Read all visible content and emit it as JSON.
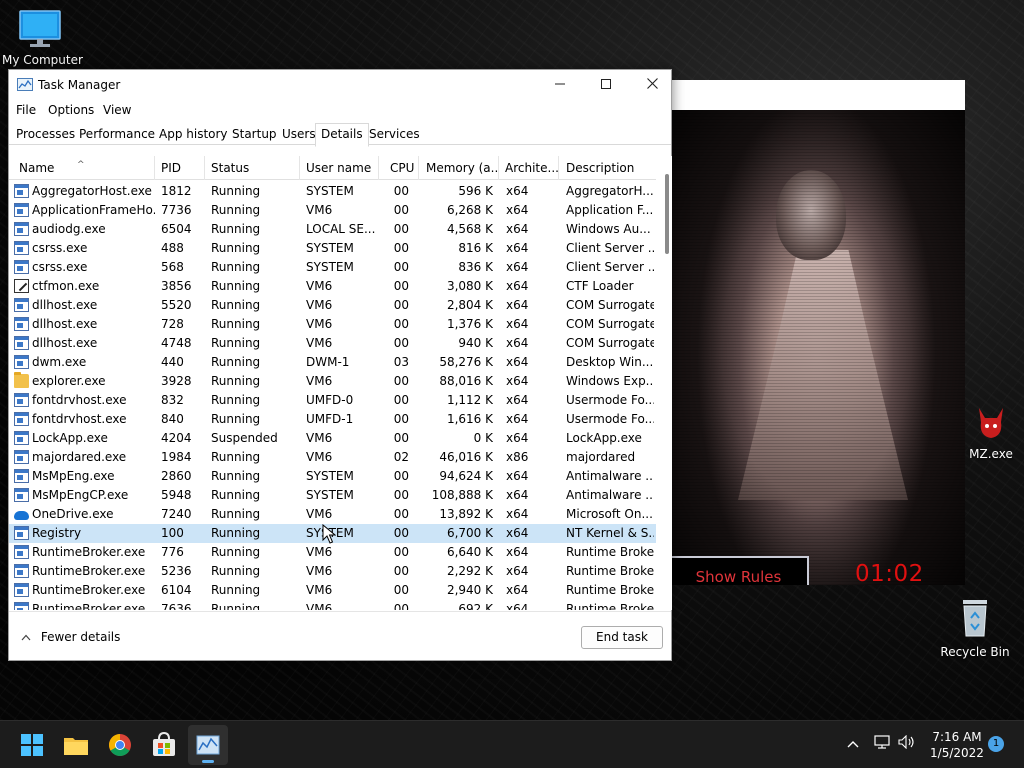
{
  "desktop": {
    "icons": {
      "my_computer": "My Computer",
      "recycle_bin": "Recycle Bin",
      "mz_exe": "MZ.exe"
    }
  },
  "game_window": {
    "show_rules_label": "Show Rules",
    "timer": "01:02"
  },
  "task_manager": {
    "title": "Task Manager",
    "menu": [
      "File",
      "Options",
      "View"
    ],
    "tabs": [
      "Processes",
      "Performance",
      "App history",
      "Startup",
      "Users",
      "Details",
      "Services"
    ],
    "active_tab": "Details",
    "columns": [
      "Name",
      "PID",
      "Status",
      "User name",
      "CPU",
      "Memory (a...",
      "Archite...",
      "Description"
    ],
    "processes": [
      {
        "name": "AggregatorHost.exe",
        "pid": "1812",
        "status": "Running",
        "user": "SYSTEM",
        "cpu": "00",
        "mem": "596 K",
        "arch": "x64",
        "desc": "AggregatorH...",
        "icon": "std"
      },
      {
        "name": "ApplicationFrameHo...",
        "pid": "7736",
        "status": "Running",
        "user": "VM6",
        "cpu": "00",
        "mem": "6,268 K",
        "arch": "x64",
        "desc": "Application F...",
        "icon": "std"
      },
      {
        "name": "audiodg.exe",
        "pid": "6504",
        "status": "Running",
        "user": "LOCAL SE...",
        "cpu": "00",
        "mem": "4,568 K",
        "arch": "x64",
        "desc": "Windows Au...",
        "icon": "std"
      },
      {
        "name": "csrss.exe",
        "pid": "488",
        "status": "Running",
        "user": "SYSTEM",
        "cpu": "00",
        "mem": "816 K",
        "arch": "x64",
        "desc": "Client Server ...",
        "icon": "std"
      },
      {
        "name": "csrss.exe",
        "pid": "568",
        "status": "Running",
        "user": "SYSTEM",
        "cpu": "00",
        "mem": "836 K",
        "arch": "x64",
        "desc": "Client Server ...",
        "icon": "std"
      },
      {
        "name": "ctfmon.exe",
        "pid": "3856",
        "status": "Running",
        "user": "VM6",
        "cpu": "00",
        "mem": "3,080 K",
        "arch": "x64",
        "desc": "CTF Loader",
        "icon": "ctf"
      },
      {
        "name": "dllhost.exe",
        "pid": "5520",
        "status": "Running",
        "user": "VM6",
        "cpu": "00",
        "mem": "2,804 K",
        "arch": "x64",
        "desc": "COM Surrogate",
        "icon": "std"
      },
      {
        "name": "dllhost.exe",
        "pid": "728",
        "status": "Running",
        "user": "VM6",
        "cpu": "00",
        "mem": "1,376 K",
        "arch": "x64",
        "desc": "COM Surrogate",
        "icon": "std"
      },
      {
        "name": "dllhost.exe",
        "pid": "4748",
        "status": "Running",
        "user": "VM6",
        "cpu": "00",
        "mem": "940 K",
        "arch": "x64",
        "desc": "COM Surrogate",
        "icon": "std"
      },
      {
        "name": "dwm.exe",
        "pid": "440",
        "status": "Running",
        "user": "DWM-1",
        "cpu": "03",
        "mem": "58,276 K",
        "arch": "x64",
        "desc": "Desktop Win...",
        "icon": "std"
      },
      {
        "name": "explorer.exe",
        "pid": "3928",
        "status": "Running",
        "user": "VM6",
        "cpu": "00",
        "mem": "88,016 K",
        "arch": "x64",
        "desc": "Windows Exp...",
        "icon": "folder"
      },
      {
        "name": "fontdrvhost.exe",
        "pid": "832",
        "status": "Running",
        "user": "UMFD-0",
        "cpu": "00",
        "mem": "1,112 K",
        "arch": "x64",
        "desc": "Usermode Fo...",
        "icon": "std"
      },
      {
        "name": "fontdrvhost.exe",
        "pid": "840",
        "status": "Running",
        "user": "UMFD-1",
        "cpu": "00",
        "mem": "1,616 K",
        "arch": "x64",
        "desc": "Usermode Fo...",
        "icon": "std"
      },
      {
        "name": "LockApp.exe",
        "pid": "4204",
        "status": "Suspended",
        "user": "VM6",
        "cpu": "00",
        "mem": "0 K",
        "arch": "x64",
        "desc": "LockApp.exe",
        "icon": "std"
      },
      {
        "name": "majordared.exe",
        "pid": "1984",
        "status": "Running",
        "user": "VM6",
        "cpu": "02",
        "mem": "46,016 K",
        "arch": "x86",
        "desc": "majordared",
        "icon": "std"
      },
      {
        "name": "MsMpEng.exe",
        "pid": "2860",
        "status": "Running",
        "user": "SYSTEM",
        "cpu": "00",
        "mem": "94,624 K",
        "arch": "x64",
        "desc": "Antimalware ...",
        "icon": "std"
      },
      {
        "name": "MsMpEngCP.exe",
        "pid": "5948",
        "status": "Running",
        "user": "SYSTEM",
        "cpu": "00",
        "mem": "108,888 K",
        "arch": "x64",
        "desc": "Antimalware ...",
        "icon": "std"
      },
      {
        "name": "OneDrive.exe",
        "pid": "7240",
        "status": "Running",
        "user": "VM6",
        "cpu": "00",
        "mem": "13,892 K",
        "arch": "x64",
        "desc": "Microsoft On...",
        "icon": "cloud"
      },
      {
        "name": "Registry",
        "pid": "100",
        "status": "Running",
        "user": "SYSTEM",
        "cpu": "00",
        "mem": "6,700 K",
        "arch": "x64",
        "desc": "NT Kernel & S...",
        "icon": "std",
        "selected": true
      },
      {
        "name": "RuntimeBroker.exe",
        "pid": "776",
        "status": "Running",
        "user": "VM6",
        "cpu": "00",
        "mem": "6,640 K",
        "arch": "x64",
        "desc": "Runtime Broker",
        "icon": "std"
      },
      {
        "name": "RuntimeBroker.exe",
        "pid": "5236",
        "status": "Running",
        "user": "VM6",
        "cpu": "00",
        "mem": "2,292 K",
        "arch": "x64",
        "desc": "Runtime Broker",
        "icon": "std"
      },
      {
        "name": "RuntimeBroker.exe",
        "pid": "6104",
        "status": "Running",
        "user": "VM6",
        "cpu": "00",
        "mem": "2,940 K",
        "arch": "x64",
        "desc": "Runtime Broker",
        "icon": "std"
      },
      {
        "name": "RuntimeBroker.exe",
        "pid": "7636",
        "status": "Running",
        "user": "VM6",
        "cpu": "00",
        "mem": "692 K",
        "arch": "x64",
        "desc": "Runtime Broker",
        "icon": "std"
      }
    ],
    "footer": {
      "fewer_details": "Fewer details",
      "end_task": "End task"
    }
  },
  "taskbar": {
    "apps": [
      "start-icon",
      "file-explorer-icon",
      "chrome-icon",
      "store-icon",
      "task-manager-icon"
    ],
    "active_app": "task-manager-icon",
    "time": "7:16 AM",
    "date": "1/5/2022",
    "notification_count": "1"
  },
  "colors": {
    "selected_row": "#cce4f7",
    "show_rules_text": "#e0343a",
    "timer": "#e01010",
    "taskbar": "#1c1c1c",
    "accent": "#5fb2f2"
  }
}
